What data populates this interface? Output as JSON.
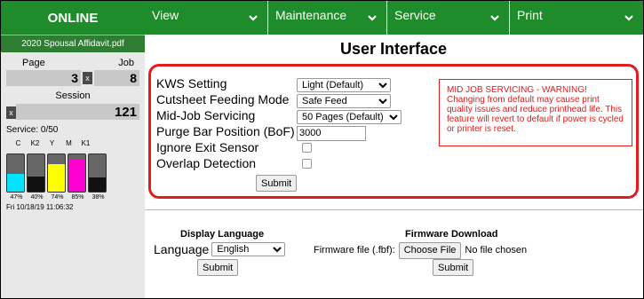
{
  "sidebar": {
    "status": "ONLINE",
    "filename": "2020 Spousal Affidavit.pdf",
    "page_label": "Page",
    "job_label": "Job",
    "page_value": "3",
    "job_value": "8",
    "clear_glyph": "x",
    "session_label": "Session",
    "session_value": "121",
    "service_text": "Service:  0/50",
    "inks": [
      {
        "label": "C",
        "pct": "47%",
        "level": 47,
        "color": "#00e5ff"
      },
      {
        "label": "K2",
        "pct": "40%",
        "level": 40,
        "color": "#111111"
      },
      {
        "label": "Y",
        "pct": "74%",
        "level": 74,
        "color": "#ffff00"
      },
      {
        "label": "M",
        "pct": "85%",
        "level": 85,
        "color": "#ff00d0"
      },
      {
        "label": "K1",
        "pct": "38%",
        "level": 38,
        "color": "#111111"
      }
    ],
    "datetime": "Fri 10/18/19 11:06:32"
  },
  "nav": {
    "items": [
      {
        "label": "View"
      },
      {
        "label": "Maintenance"
      },
      {
        "label": "Service"
      },
      {
        "label": "Print"
      }
    ]
  },
  "main": {
    "title": "User Interface",
    "settings": {
      "kws_label": "KWS Setting",
      "kws_value": "Light (Default)",
      "cutsheet_label": "Cutsheet Feeding Mode",
      "cutsheet_value": "Safe Feed",
      "midjob_label": "Mid-Job Servicing",
      "midjob_value": "50 Pages (Default)",
      "purge_label": "Purge Bar Position (BoF)",
      "purge_value": "3000",
      "ignore_label": "Ignore Exit Sensor",
      "overlap_label": "Overlap Detection",
      "submit_label": "Submit",
      "warning_text": "MID JOB SERVICING - WARNING! Changing from default may cause print quality issues and reduce printhead life. This feature will revert to default if power is cycled or printer is reset."
    },
    "language": {
      "title": "Display Language",
      "label": "Language",
      "value": "English",
      "submit_label": "Submit"
    },
    "firmware": {
      "title": "Firmware Download",
      "label": "Firmware file (.fbf):",
      "choose_label": "Choose File",
      "no_file_text": "No file chosen",
      "submit_label": "Submit"
    }
  },
  "colors": {
    "brand_green": "#1e8c2a",
    "warning_red": "#e21b1b"
  }
}
